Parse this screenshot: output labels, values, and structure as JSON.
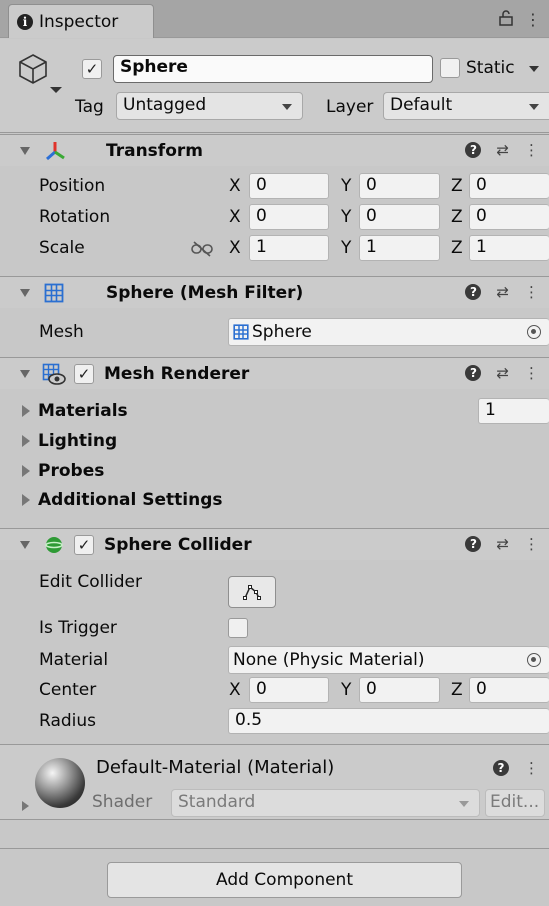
{
  "tab": {
    "title": "Inspector"
  },
  "gameobject": {
    "name": "Sphere",
    "active": true,
    "static_label": "Static",
    "tag_label": "Tag",
    "tag_value": "Untagged",
    "layer_label": "Layer",
    "layer_value": "Default"
  },
  "transform": {
    "title": "Transform",
    "position": {
      "label": "Position",
      "x": "0",
      "y": "0",
      "z": "0"
    },
    "rotation": {
      "label": "Rotation",
      "x": "0",
      "y": "0",
      "z": "0"
    },
    "scale": {
      "label": "Scale",
      "x": "1",
      "y": "1",
      "z": "1"
    },
    "axis": {
      "x": "X",
      "y": "Y",
      "z": "Z"
    }
  },
  "mesh_filter": {
    "title": "Sphere (Mesh Filter)",
    "mesh_label": "Mesh",
    "mesh_value": "Sphere"
  },
  "mesh_renderer": {
    "title": "Mesh Renderer",
    "enabled": true,
    "materials_label": "Materials",
    "materials_count": "1",
    "lighting_label": "Lighting",
    "probes_label": "Probes",
    "additional_label": "Additional Settings"
  },
  "sphere_collider": {
    "title": "Sphere Collider",
    "enabled": true,
    "edit_collider_label": "Edit Collider",
    "is_trigger_label": "Is Trigger",
    "material_label": "Material",
    "material_value": "None (Physic Material)",
    "center_label": "Center",
    "center": {
      "x": "0",
      "y": "0",
      "z": "0"
    },
    "radius_label": "Radius",
    "radius_value": "0.5"
  },
  "material": {
    "title": "Default-Material (Material)",
    "shader_label": "Shader",
    "shader_value": "Standard",
    "edit_label": "Edit..."
  },
  "footer": {
    "add_component_label": "Add Component"
  },
  "colors": {
    "panel_bg": "#c8c8c8",
    "header_bg": "#cbcbcb",
    "tabbar_bg": "#a5a5a5",
    "transform_icon_red": "#e0332b",
    "transform_icon_green": "#3aa935",
    "transform_icon_blue": "#2c6fd6",
    "mesh_icon_blue": "#2a6fd1",
    "collider_green": "#2e9a35"
  }
}
